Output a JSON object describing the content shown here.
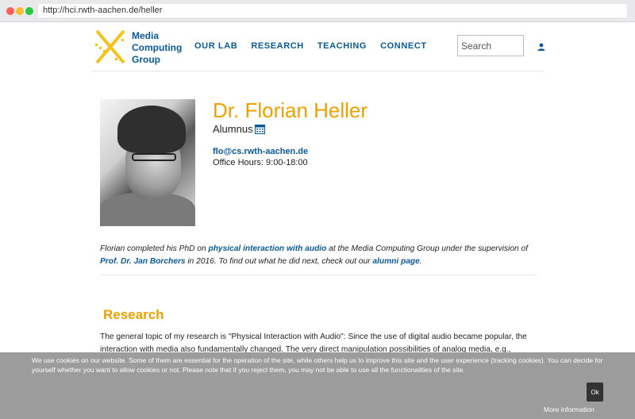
{
  "browser": {
    "url": "http://hci.rwth-aachen.de/heller"
  },
  "header": {
    "logo_lines": [
      "Media",
      "Computing",
      "Group"
    ],
    "nav": [
      "OUR LAB",
      "RESEARCH",
      "TEACHING",
      "CONNECT"
    ],
    "search_placeholder": "Search"
  },
  "profile": {
    "name": "Dr. Florian Heller",
    "role": "Alumnus",
    "email": "flo@cs.rwth-aachen.de",
    "office_hours": "Office Hours: 9:00-18:00"
  },
  "bio": {
    "part1": "Florian completed his PhD on ",
    "link1": "physical interaction with audio",
    "part2": " at the Media Computing Group under the supervision of ",
    "link2": "Prof. Dr. Jan Borchers",
    "part3": " in 2016. To find out what he did next, check out our ",
    "link3": "alumni page",
    "part4": "."
  },
  "research": {
    "title": "Research",
    "text": "The general topic of my research is \"Physical Interaction with Audio\": Since the use of digital audio became popular, the interaction with media also fundamentally changed. The very direct manipulation possibilities of analog media, e.g., cutting and"
  },
  "cookie": {
    "text": "We use cookies on our website. Some of them are essential for the operation of the site, while others help us to improve this site and the user experience (tracking cookies). You can decide for yourself whether you want to allow cookies or not. Please note that if you reject them, you may not be able to use all the functionalities of the site.",
    "ok_label": "Ok",
    "more_info_label": "More information"
  },
  "colors": {
    "accent": "#f0a100",
    "link": "#0a5a9a"
  }
}
